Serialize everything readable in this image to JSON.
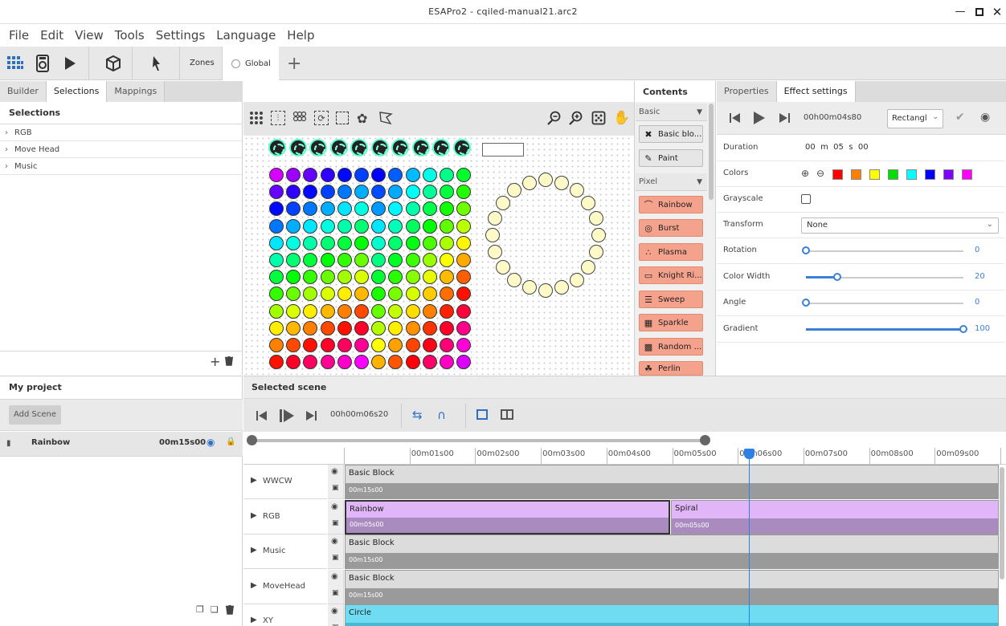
{
  "window": {
    "title": "ESAPro2 - cqiled-manual21.arc2"
  },
  "menu": [
    "File",
    "Edit",
    "View",
    "Tools",
    "Settings",
    "Language",
    "Help"
  ],
  "toolbar": {
    "zones_label": "Zones",
    "global_label": "Global"
  },
  "left_tabs": [
    "Builder",
    "Selections",
    "Mappings"
  ],
  "selections": {
    "header": "Selections",
    "items": [
      "RGB",
      "Move Head",
      "Music"
    ]
  },
  "project": {
    "header": "My project",
    "add_scene": "Add Scene",
    "scene_name": "Rainbow",
    "scene_duration": "00m15s00"
  },
  "contents": {
    "tab": "Contents",
    "sections": [
      "Basic",
      "Pixel"
    ],
    "basic_items": [
      "Basic blo...",
      "Paint"
    ],
    "pixel_items": [
      "Rainbow",
      "Burst",
      "Plasma",
      "Knight Ri...",
      "Sweep",
      "Sparkle",
      "Random ...",
      "Perlin"
    ]
  },
  "right_tabs": [
    "Properties",
    "Effect settings"
  ],
  "effect": {
    "time": "00h00m04s80",
    "shape": "Rectangl",
    "duration_label": "Duration",
    "duration_value": "00  m  05  s  00",
    "colors_label": "Colors",
    "colors": [
      "#ff0000",
      "#ff8000",
      "#ffff00",
      "#00e000",
      "#00ffff",
      "#0000ff",
      "#8000ff",
      "#ff00ff"
    ],
    "grayscale_label": "Grayscale",
    "transform_label": "Transform",
    "transform_value": "None",
    "sliders": [
      {
        "label": "Rotation",
        "value": "0",
        "fraction": 0
      },
      {
        "label": "Color Width",
        "value": "20",
        "fraction": 0.2
      },
      {
        "label": "Angle",
        "value": "0",
        "fraction": 0
      },
      {
        "label": "Gradient",
        "value": "100",
        "fraction": 1
      }
    ]
  },
  "scene": {
    "header": "Selected scene",
    "time": "00h00m06s20",
    "ruler": [
      "00m01s00",
      "00m02s00",
      "00m03s00",
      "00m04s00",
      "00m05s00",
      "00m06s00",
      "00m07s00",
      "00m08s00",
      "00m09s00"
    ],
    "tracks": [
      {
        "name": "WWCW",
        "clips": [
          {
            "label": "Basic Block",
            "time": "00m15s00"
          }
        ]
      },
      {
        "name": "RGB",
        "clips": [
          {
            "label": "Rainbow",
            "time": "00m05s00"
          },
          {
            "label": "Spiral",
            "time": "00m05s00"
          }
        ]
      },
      {
        "name": "Music",
        "clips": [
          {
            "label": "Basic Block",
            "time": "00m15s00"
          }
        ]
      },
      {
        "name": "MoveHead",
        "clips": [
          {
            "label": "Basic Block",
            "time": "00m15s00"
          }
        ]
      },
      {
        "name": "XY",
        "clips": [
          {
            "label": "Circle",
            "time": ""
          }
        ]
      }
    ]
  },
  "colors": {
    "accent": "#3c7fd6",
    "pixel_effect": "#f4a28c",
    "rgb_clip": "#e0b6f8",
    "xy_clip": "#6fdcf2",
    "block_clip": "#dcdcdc"
  }
}
